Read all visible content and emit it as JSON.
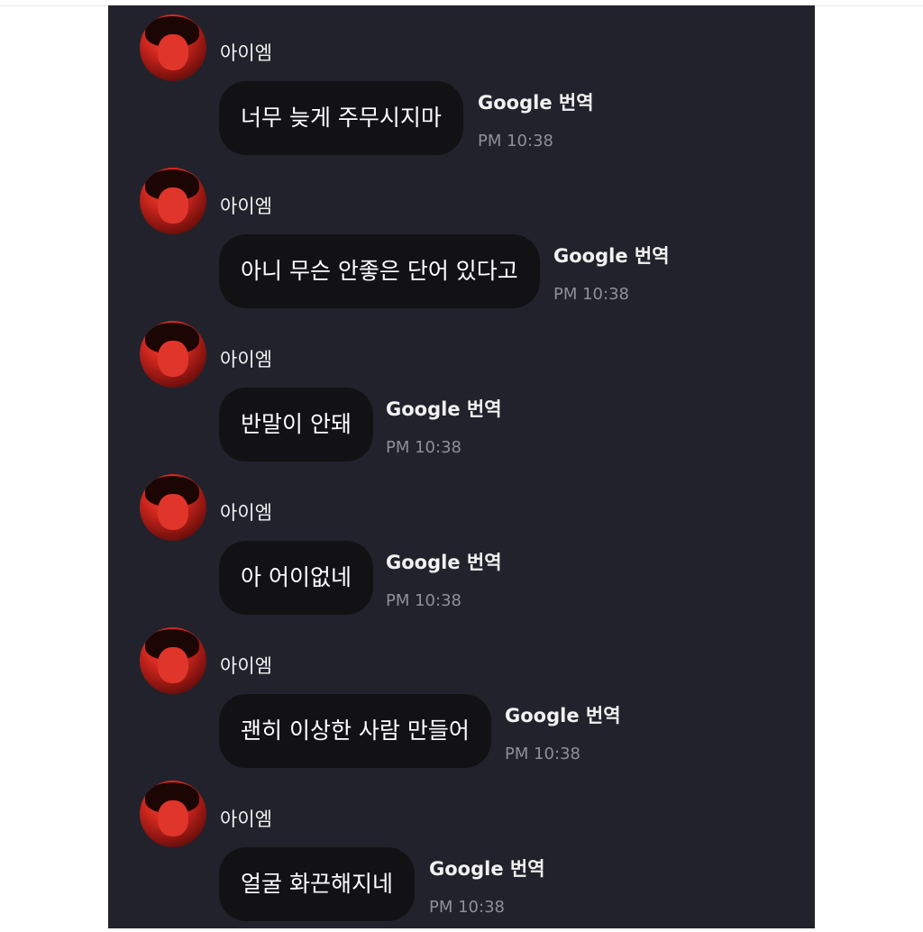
{
  "messages": [
    {
      "sender": "아이엠",
      "text": "너무 늦게 주무시지마",
      "translate": "Google 번역",
      "time": "PM 10:38"
    },
    {
      "sender": "아이엠",
      "text": "아니 무슨 안좋은 단어 있다고",
      "translate": "Google 번역",
      "time": "PM 10:38"
    },
    {
      "sender": "아이엠",
      "text": "반말이 안돼",
      "translate": "Google 번역",
      "time": "PM 10:38"
    },
    {
      "sender": "아이엠",
      "text": "아 어이없네",
      "translate": "Google 번역",
      "time": "PM 10:38"
    },
    {
      "sender": "아이엠",
      "text": "괜히 이상한 사람 만들어",
      "translate": "Google 번역",
      "time": "PM 10:38"
    },
    {
      "sender": "아이엠",
      "text": "얼굴 화끈해지네",
      "translate": "Google 번역",
      "time": "PM 10:38"
    }
  ]
}
